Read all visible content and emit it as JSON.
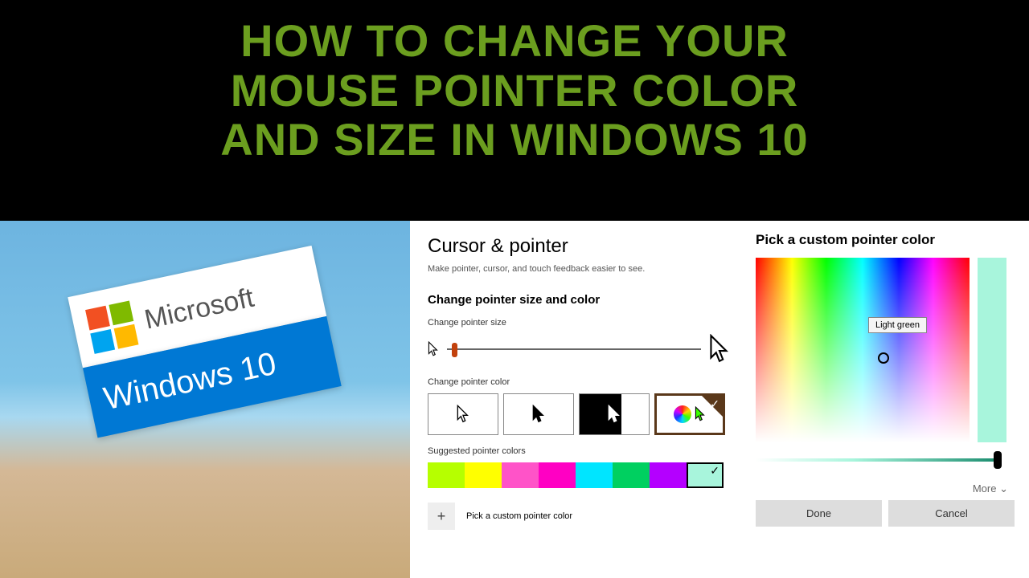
{
  "title_line1": "HOW TO CHANGE YOUR",
  "title_line2": "MOUSE POINTER COLOR",
  "title_line3": "AND SIZE IN WINDOWS 10",
  "photo": {
    "brand": "Microsoft",
    "product": "Windows 10"
  },
  "settings": {
    "heading": "Cursor & pointer",
    "description": "Make pointer, cursor, and touch feedback easier to see.",
    "section_heading": "Change pointer size and color",
    "size_label": "Change pointer size",
    "color_label": "Change pointer color",
    "suggested_label": "Suggested pointer colors",
    "suggested_colors": [
      "#b6ff00",
      "#ffff00",
      "#ff53c8",
      "#ff00c3",
      "#00e5ff",
      "#00d060",
      "#b400ff",
      "#a8f5dc"
    ],
    "selected_suggested_index": 7,
    "pick_custom_label": "Pick a custom pointer color"
  },
  "color_picker": {
    "heading": "Pick a custom pointer color",
    "tooltip": "Light green",
    "more": "More",
    "done": "Done",
    "cancel": "Cancel"
  }
}
